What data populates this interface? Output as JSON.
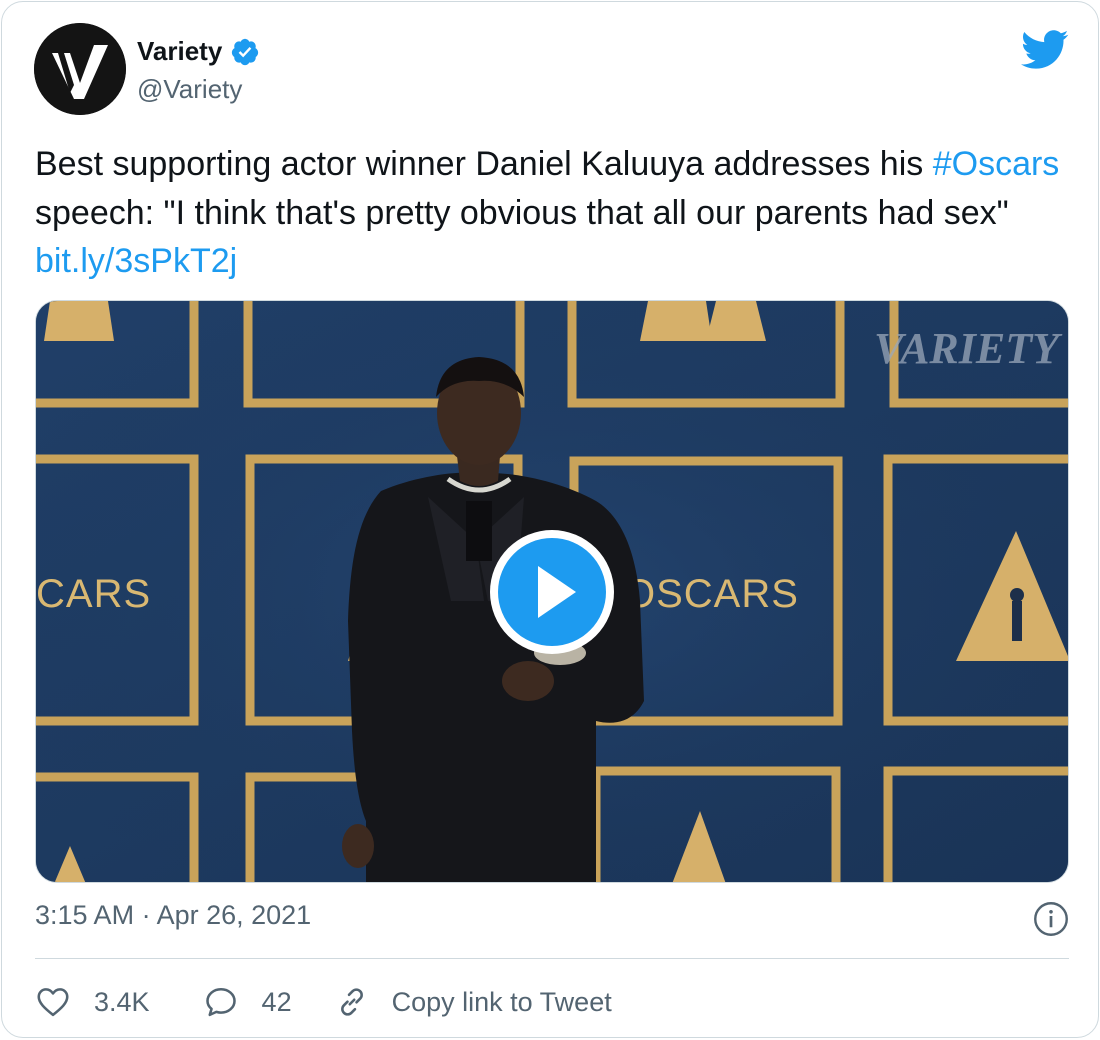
{
  "author": {
    "name": "Variety",
    "handle": "@Variety",
    "avatar_icon": "variety-v-logo",
    "verified_icon": "verified-badge-icon"
  },
  "tweet": {
    "text_1": "Best supporting actor winner Daniel Kaluuya addresses his ",
    "hashtag": "#Oscars",
    "text_2": " speech: \"I think that's pretty obvious that all our parents had sex\" ",
    "link": "bit.ly/3sPkT2j"
  },
  "media": {
    "type": "video",
    "watermark": "VARIETY",
    "backdrop_text_left": "CARS",
    "backdrop_text_right": "OSCARS",
    "play_icon": "play-icon"
  },
  "timestamp": "3:15 AM · Apr 26, 2021",
  "actions": {
    "likes": "3.4K",
    "replies": "42",
    "copy_link": "Copy link to Tweet"
  },
  "colors": {
    "accent": "#1d9bf0",
    "text": "#0f1419",
    "secondary": "#536471",
    "border": "#cfd9de",
    "backdrop_blue": "#1f3c64",
    "gold": "#c9a35a"
  }
}
